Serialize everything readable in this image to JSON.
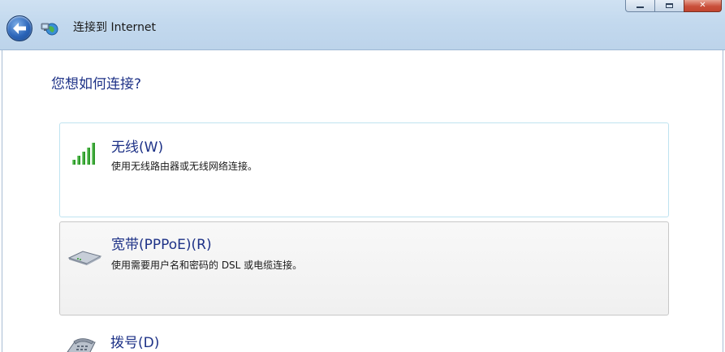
{
  "window": {
    "title": "连接到 Internet",
    "icons": {
      "back": "back-arrow-icon",
      "app": "network-globe-icon"
    },
    "caption_buttons": {
      "minimize": "minimize-icon",
      "maximize": "maximize-icon",
      "close": "close-icon"
    }
  },
  "main": {
    "heading": "您想如何连接?",
    "options": [
      {
        "title": "无线(W)",
        "description": "使用无线路由器或无线网络连接。",
        "icon": "wireless-signal-icon"
      },
      {
        "title": "宽带(PPPoE)(R)",
        "description": "使用需要用户名和密码的 DSL 或电缆连接。",
        "icon": "broadband-modem-icon"
      },
      {
        "title": "拨号(D)",
        "description": "",
        "icon": "dialup-phone-icon"
      }
    ]
  },
  "colors": {
    "link_blue": "#1e3287",
    "header_glass": "#c3d9ee",
    "close_red": "#c9503b",
    "wireless_green": "#2e9a2a"
  }
}
